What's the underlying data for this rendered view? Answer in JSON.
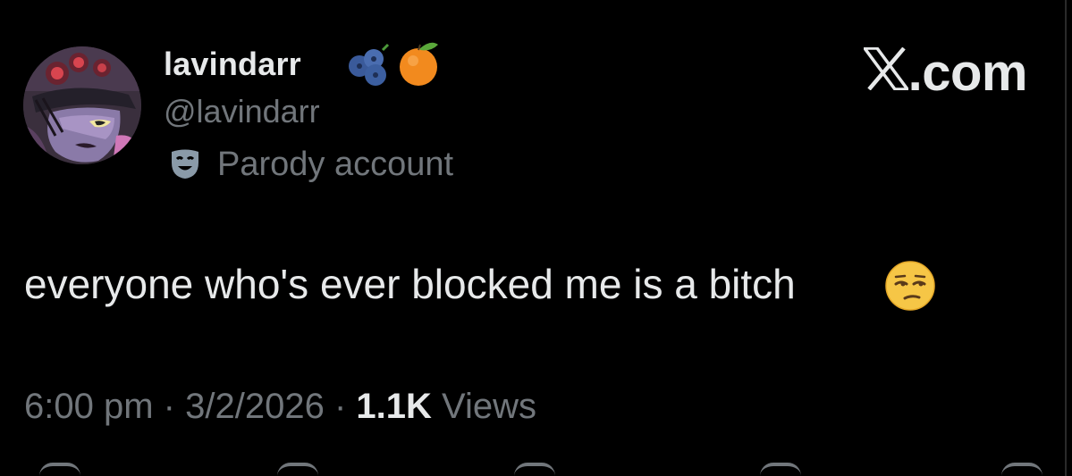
{
  "author": {
    "display_name": "lavindarr",
    "name_emojis": [
      "blueberries-emoji",
      "orange-emoji"
    ],
    "handle": "@lavindarr",
    "label_icon": "theater-mask-icon",
    "label": "Parody account"
  },
  "brand": {
    "text": ".com",
    "icon": "x-logo-icon"
  },
  "tweet": {
    "text": "everyone who's ever blocked me is a bitch",
    "emoji": "unamused-face-emoji"
  },
  "meta": {
    "time": "6:00 pm",
    "separator": "·",
    "date": "3/2/2026",
    "views_count": "1.1K",
    "views_label": "Views"
  },
  "actions": [
    "reply-icon",
    "retweet-icon",
    "like-icon",
    "bookmark-icon",
    "share-icon"
  ],
  "colors": {
    "background": "#000000",
    "primary_text": "#e7e9ea",
    "secondary_text": "#71767b"
  }
}
